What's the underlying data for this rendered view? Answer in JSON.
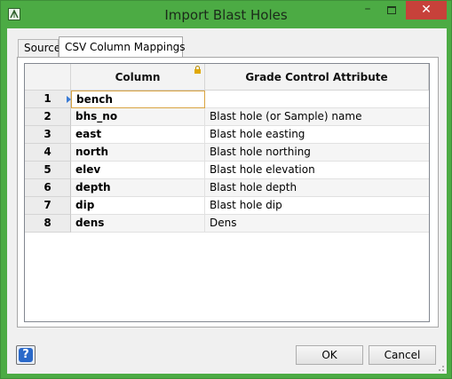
{
  "window": {
    "title": "Import Blast Holes",
    "controls": {
      "minimize": "–",
      "close": "✕"
    }
  },
  "tabs": [
    {
      "label": "Source",
      "active": false
    },
    {
      "label": "CSV Column Mappings",
      "active": true
    }
  ],
  "grid": {
    "headers": {
      "column": "Column",
      "attribute": "Grade Control Attribute"
    },
    "rows": [
      {
        "num": "1",
        "column": "bench",
        "attribute": ""
      },
      {
        "num": "2",
        "column": "bhs_no",
        "attribute": "Blast hole (or Sample) name"
      },
      {
        "num": "3",
        "column": "east",
        "attribute": "Blast hole easting"
      },
      {
        "num": "4",
        "column": "north",
        "attribute": "Blast hole northing"
      },
      {
        "num": "5",
        "column": "elev",
        "attribute": "Blast hole elevation"
      },
      {
        "num": "6",
        "column": "depth",
        "attribute": "Blast hole depth"
      },
      {
        "num": "7",
        "column": "dip",
        "attribute": "Blast hole dip"
      },
      {
        "num": "8",
        "column": "dens",
        "attribute": "Dens"
      }
    ]
  },
  "footer": {
    "help": "?",
    "ok": "OK",
    "cancel": "Cancel"
  },
  "colors": {
    "titlebar": "#4cab44",
    "close": "#c7413a",
    "help": "#2a69c9"
  }
}
